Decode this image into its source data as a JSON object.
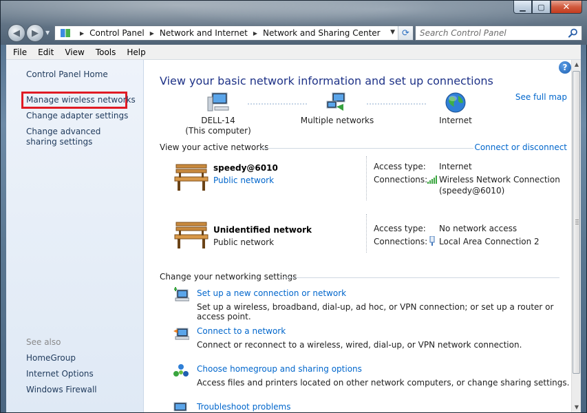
{
  "window": {
    "caption_buttons": {
      "minimize": "▁",
      "maximize": "▢",
      "close": "✕"
    }
  },
  "address_bar": {
    "breadcrumbs": [
      "Control Panel",
      "Network and Internet",
      "Network and Sharing Center"
    ],
    "search_placeholder": "Search Control Panel"
  },
  "menu": [
    "File",
    "Edit",
    "View",
    "Tools",
    "Help"
  ],
  "sidebar": {
    "home": "Control Panel Home",
    "tasks": [
      "Manage wireless networks",
      "Change adapter settings",
      "Change advanced sharing settings"
    ],
    "highlighted_task": "Manage wireless networks",
    "see_also_label": "See also",
    "see_also": [
      "HomeGroup",
      "Internet Options",
      "Windows Firewall"
    ]
  },
  "main": {
    "title": "View your basic network information and set up connections",
    "see_full_map": "See full map",
    "map_nodes": [
      {
        "label": "DELL-14",
        "sublabel": "(This computer)",
        "icon": "computer-icon"
      },
      {
        "label": "Multiple networks",
        "sublabel": "",
        "icon": "multiple-networks-icon"
      },
      {
        "label": "Internet",
        "sublabel": "",
        "icon": "globe-icon"
      }
    ],
    "active_networks_heading": "View your active networks",
    "connect_or_disconnect": "Connect or disconnect",
    "networks": [
      {
        "name": "speedy@6010",
        "type": "Public network",
        "type_is_link": true,
        "access_type_label": "Access type:",
        "access_type": "Internet",
        "connections_label": "Connections:",
        "connection": "Wireless Network Connection\n(speedy@6010)",
        "connection_line1": "Wireless Network Connection",
        "connection_line2": "(speedy@6010)",
        "connection_icon": "wireless-signal-icon"
      },
      {
        "name": "Unidentified network",
        "type": "Public network",
        "type_is_link": false,
        "access_type_label": "Access type:",
        "access_type": "No network access",
        "connections_label": "Connections:",
        "connection_line1": "Local Area Connection 2",
        "connection_icon": "ethernet-icon"
      }
    ],
    "settings_heading": "Change your networking settings",
    "tasks": [
      {
        "title": "Set up a new connection or network",
        "desc": "Set up a wireless, broadband, dial-up, ad hoc, or VPN connection; or set up a router or access point.",
        "icon": "new-connection-icon"
      },
      {
        "title": "Connect to a network",
        "desc": "Connect or reconnect to a wireless, wired, dial-up, or VPN network connection.",
        "icon": "connect-network-icon"
      },
      {
        "title": "Choose homegroup and sharing options",
        "desc": "Access files and printers located on other network computers, or change sharing settings.",
        "icon": "homegroup-icon"
      },
      {
        "title": "Troubleshoot problems",
        "desc": "",
        "icon": "troubleshoot-icon"
      }
    ]
  },
  "colors": {
    "link": "#0066cc",
    "title": "#1e3287",
    "highlight_border": "#e01b24"
  }
}
